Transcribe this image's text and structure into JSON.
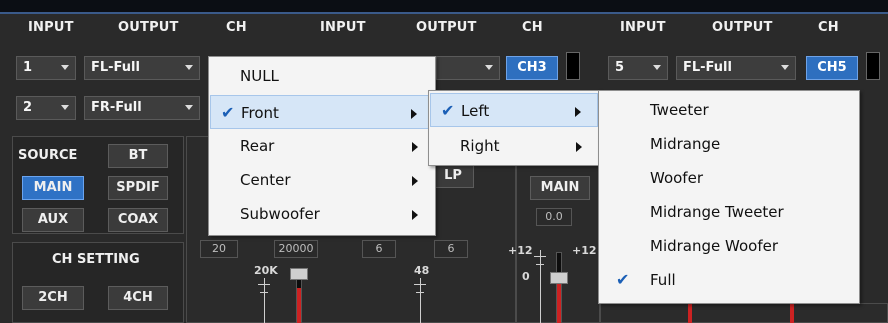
{
  "headers": {
    "group1": {
      "input": "INPUT",
      "output": "OUTPUT",
      "ch": "CH"
    },
    "group2": {
      "input": "INPUT",
      "output": "OUTPUT",
      "ch": "CH"
    },
    "group3": {
      "input": "INPUT",
      "output": "OUTPUT",
      "ch": "CH"
    }
  },
  "rows": {
    "r1": {
      "input": "1",
      "output": "FL-Full"
    },
    "r2": {
      "input": "2",
      "output": "FR-Full"
    },
    "g2": {
      "ch": "CH3"
    },
    "g3": {
      "input": "5",
      "output": "FL-Full",
      "ch": "CH5"
    }
  },
  "left_panel": {
    "source_label": "SOURCE",
    "bt": "BT",
    "main": "MAIN",
    "spdif": "SPDIF",
    "aux": "AUX",
    "coax": "COAX",
    "ch_setting_label": "CH SETTING",
    "ch2": "2CH",
    "ch4": "4CH"
  },
  "mixer": {
    "lp_button": "LP",
    "main_button": "MAIN",
    "value_00": "0.0",
    "low_boxes": [
      "20",
      "20000",
      "6",
      "6"
    ],
    "freq_label": "20K",
    "gain_label": "48",
    "plus12_a": "+12",
    "plus12_b": "+12",
    "zero_label": "0"
  },
  "menus": {
    "main_menu": {
      "items": [
        "NULL",
        "Front",
        "Rear",
        "Center",
        "Subwoofer"
      ],
      "checked_index": 1,
      "highlight_index": 1
    },
    "front_submenu": {
      "items": [
        "Left",
        "Right"
      ],
      "checked_index": 0,
      "highlight_index": 0
    },
    "left_submenu": {
      "items": [
        "Tweeter",
        "Midrange",
        "Woofer",
        "Midrange Tweeter",
        "Midrange Woofer",
        "Full"
      ],
      "checked_index": 5
    }
  },
  "icons": {
    "check": "✔",
    "submenu_arrow": "submenu-arrow-icon",
    "dropdown_arrow": "chevron-down-icon"
  },
  "colors": {
    "accent_blue": "#2f72c5",
    "menu_bg": "#f4f4f4",
    "highlight": "#d6e6f7",
    "slider_red": "#cc2222"
  }
}
